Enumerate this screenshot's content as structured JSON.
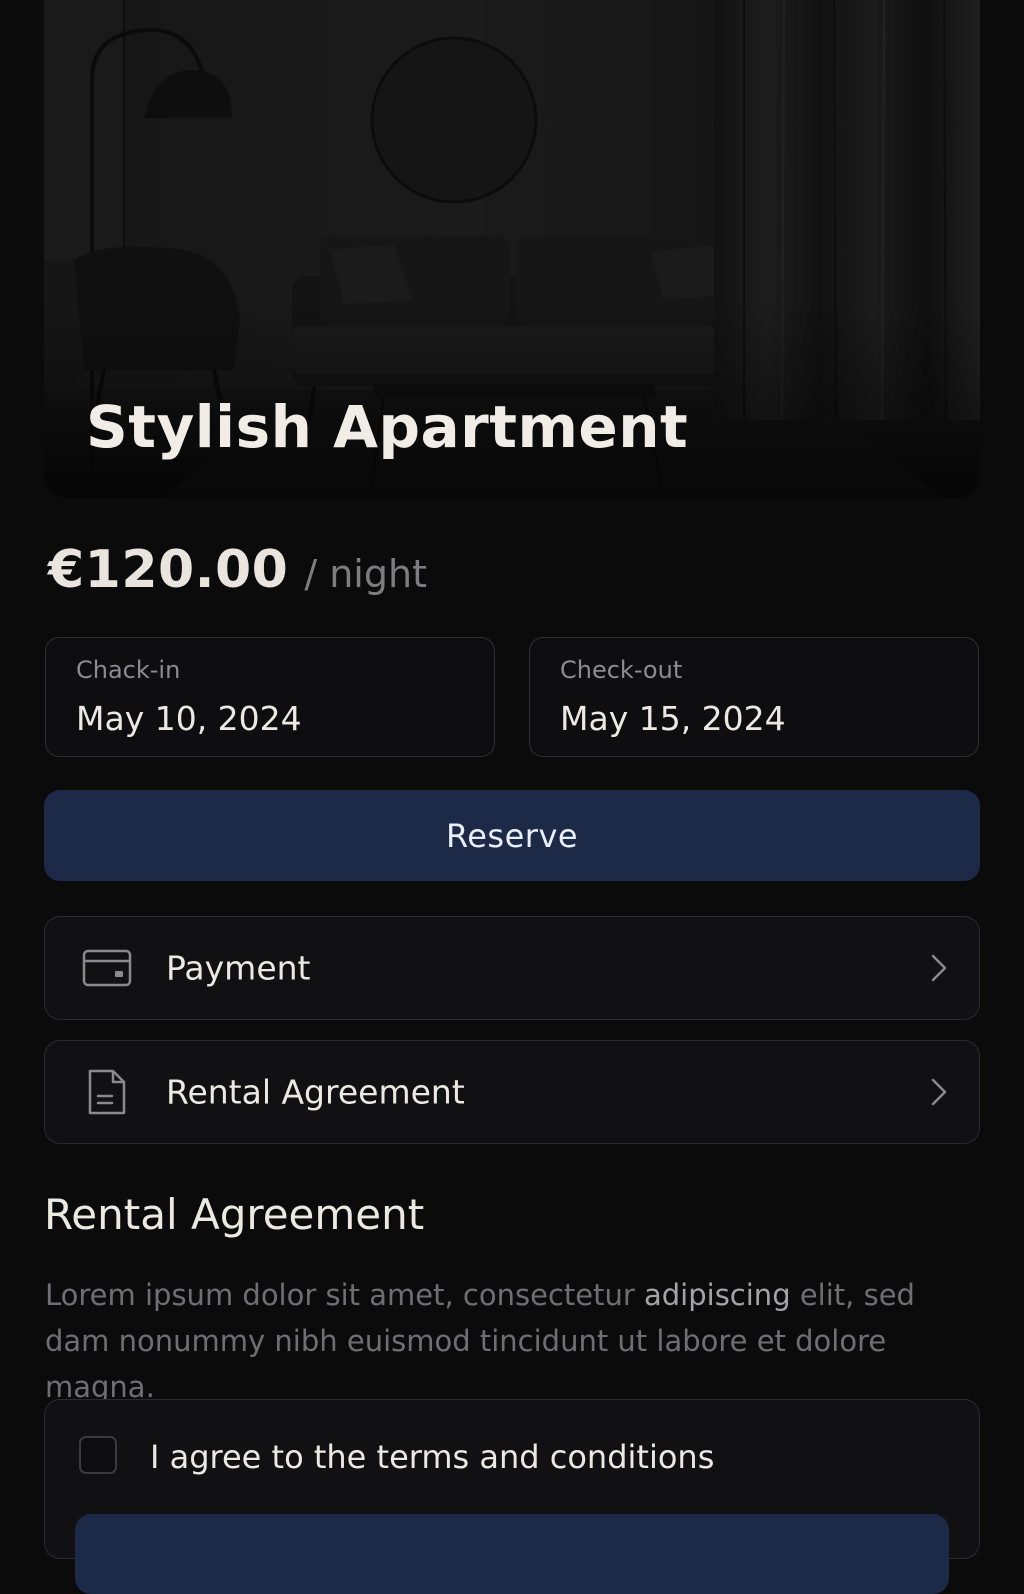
{
  "listing": {
    "title": "Stylish Apartment",
    "price": "€120.00",
    "price_unit": "/ night"
  },
  "dates": {
    "checkin_label": "Chack-in",
    "checkin_value": "May 10, 2024",
    "checkout_label": "Check-out",
    "checkout_value": "May 15, 2024"
  },
  "actions": {
    "reserve_label": "Reserve"
  },
  "menu": {
    "items": [
      {
        "label": "Payment",
        "icon": "credit-card-icon"
      },
      {
        "label": "Rental Agreement",
        "icon": "document-icon"
      }
    ]
  },
  "agreement": {
    "heading": "Rental Agreement",
    "body_part1": "Lorem ipsum dolor sit amet, consectetur ",
    "body_highlight": "adipiscing",
    "body_part2": " elit, sed dam nonummy nibh euismod tincidunt ut labore et dolore magna.",
    "terms_label": "I agree to the terms and conditions",
    "terms_checked": false
  },
  "colors": {
    "background": "#0b0b0c",
    "accent": "#1c2a48",
    "card": "#111113",
    "border": "#2a2b2f",
    "text": "#ece8e2",
    "muted": "#6f6f73"
  }
}
